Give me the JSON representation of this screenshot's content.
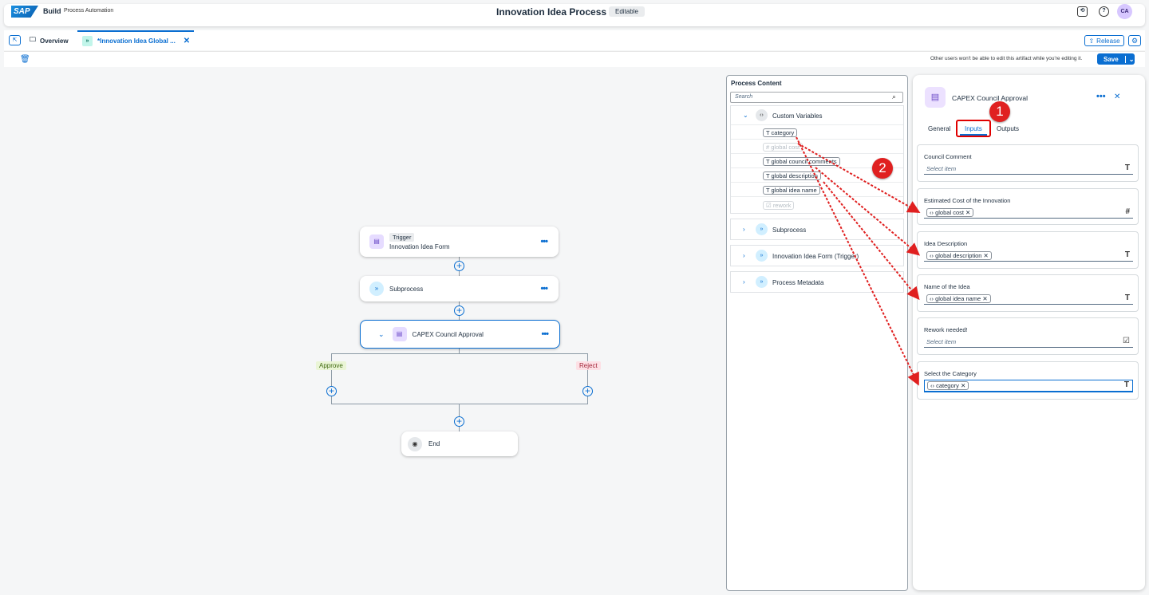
{
  "shell": {
    "logo": "SAP",
    "brand": "Build",
    "product": "Process Automation",
    "title": "Innovation Idea Process",
    "status_badge": "Editable",
    "avatar": "CA"
  },
  "tabs": {
    "overview": "Overview",
    "active": "*Innovation Idea Global ...",
    "release": "Release"
  },
  "toolbar": {
    "edit_note": "Other users won't be able to edit this artifact while you're editing it.",
    "save": "Save"
  },
  "canvas": {
    "trigger_badge": "Trigger",
    "trigger_label": "Innovation Idea Form",
    "subprocess_label": "Subprocess",
    "approval_label": "CAPEX Council Approval",
    "approve": "Approve",
    "reject": "Reject",
    "end": "End"
  },
  "process_content": {
    "title": "Process Content",
    "search_placeholder": "Search",
    "custom_variables": "Custom Variables",
    "variables": [
      "category",
      "global cost",
      "global council comments",
      "global description",
      "global idea name",
      "rework"
    ],
    "groups": [
      "Subprocess",
      "Innovation Idea Form (Trigger)",
      "Process Metadata"
    ]
  },
  "properties": {
    "title": "CAPEX Council Approval",
    "tabs": [
      "General",
      "Inputs",
      "Outputs"
    ],
    "active_tab": "Inputs",
    "fields": [
      {
        "label": "Council Comment",
        "placeholder": "Select item",
        "value": "",
        "type": "T"
      },
      {
        "label": "Estimated Cost of the Innovation",
        "placeholder": "",
        "value": "global cost",
        "type": "#"
      },
      {
        "label": "Idea Description",
        "placeholder": "",
        "value": "global description",
        "type": "T"
      },
      {
        "label": "Name of the Idea",
        "placeholder": "",
        "value": "global idea name",
        "type": "T"
      },
      {
        "label": "Rework needed!",
        "placeholder": "Select item",
        "value": "",
        "type": "☑"
      },
      {
        "label": "Select the Category",
        "placeholder": "",
        "value": "category",
        "type": "T"
      }
    ]
  },
  "annotations": {
    "step1": "1",
    "step2": "2"
  },
  "colors": {
    "accent": "#0a6ed1",
    "annotation": "#e02020"
  }
}
